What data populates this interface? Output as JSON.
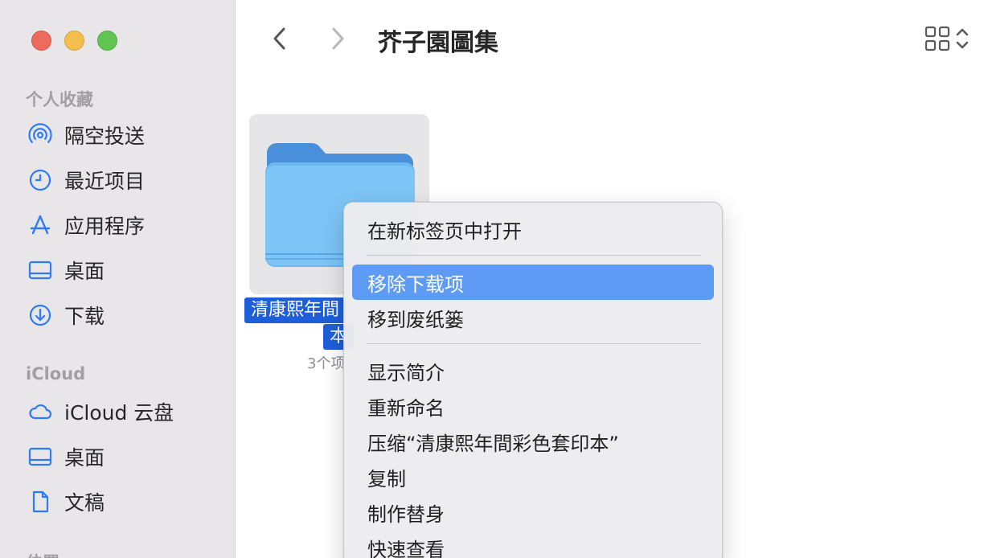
{
  "window": {
    "title": "芥子園圖集"
  },
  "sidebar": {
    "favorites_title": "个人收藏",
    "favorites": [
      {
        "label": "隔空投送",
        "icon": "airdrop-icon"
      },
      {
        "label": "最近项目",
        "icon": "clock-icon"
      },
      {
        "label": "应用程序",
        "icon": "applications-icon"
      },
      {
        "label": "桌面",
        "icon": "desktop-icon"
      },
      {
        "label": "下载",
        "icon": "download-icon"
      }
    ],
    "icloud_title": "iCloud",
    "icloud": [
      {
        "label": "iCloud 云盘",
        "icon": "cloud-icon"
      },
      {
        "label": "桌面",
        "icon": "desktop-icon"
      },
      {
        "label": "文稿",
        "icon": "document-icon"
      }
    ],
    "locations_title": "位置"
  },
  "content": {
    "folder": {
      "name_line1": "清康熙年間",
      "name_line2": "本",
      "meta": "3个项"
    }
  },
  "context_menu": {
    "items": [
      {
        "label": "在新标签页中打开",
        "highlighted": false
      },
      {
        "label": "移除下载项",
        "highlighted": true
      },
      {
        "label": "移到废纸篓",
        "highlighted": false
      },
      {
        "label": "显示简介",
        "highlighted": false
      },
      {
        "label": "重新命名",
        "highlighted": false
      },
      {
        "label": "压缩“清康熙年間彩色套印本”",
        "highlighted": false
      },
      {
        "label": "复制",
        "highlighted": false
      },
      {
        "label": "制作替身",
        "highlighted": false
      },
      {
        "label": "快速查看",
        "highlighted": false
      }
    ]
  },
  "colors": {
    "accent": "#1e5fd9",
    "menu_highlight": "#5d9bf5",
    "sidebar_icon": "#2f7bf6",
    "folder": "#6fbff3"
  }
}
